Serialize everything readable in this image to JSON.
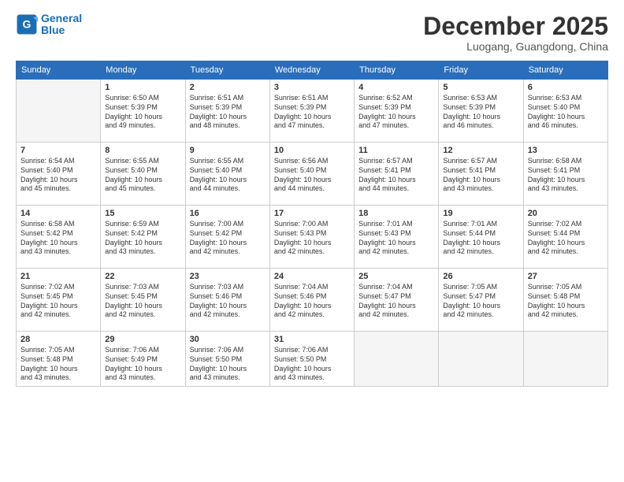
{
  "logo": {
    "line1": "General",
    "line2": "Blue"
  },
  "title": "December 2025",
  "location": "Luogang, Guangdong, China",
  "weekdays": [
    "Sunday",
    "Monday",
    "Tuesday",
    "Wednesday",
    "Thursday",
    "Friday",
    "Saturday"
  ],
  "weeks": [
    [
      {
        "day": "",
        "info": ""
      },
      {
        "day": "1",
        "info": "Sunrise: 6:50 AM\nSunset: 5:39 PM\nDaylight: 10 hours\nand 49 minutes."
      },
      {
        "day": "2",
        "info": "Sunrise: 6:51 AM\nSunset: 5:39 PM\nDaylight: 10 hours\nand 48 minutes."
      },
      {
        "day": "3",
        "info": "Sunrise: 6:51 AM\nSunset: 5:39 PM\nDaylight: 10 hours\nand 47 minutes."
      },
      {
        "day": "4",
        "info": "Sunrise: 6:52 AM\nSunset: 5:39 PM\nDaylight: 10 hours\nand 47 minutes."
      },
      {
        "day": "5",
        "info": "Sunrise: 6:53 AM\nSunset: 5:39 PM\nDaylight: 10 hours\nand 46 minutes."
      },
      {
        "day": "6",
        "info": "Sunrise: 6:53 AM\nSunset: 5:40 PM\nDaylight: 10 hours\nand 46 minutes."
      }
    ],
    [
      {
        "day": "7",
        "info": "Sunrise: 6:54 AM\nSunset: 5:40 PM\nDaylight: 10 hours\nand 45 minutes."
      },
      {
        "day": "8",
        "info": "Sunrise: 6:55 AM\nSunset: 5:40 PM\nDaylight: 10 hours\nand 45 minutes."
      },
      {
        "day": "9",
        "info": "Sunrise: 6:55 AM\nSunset: 5:40 PM\nDaylight: 10 hours\nand 44 minutes."
      },
      {
        "day": "10",
        "info": "Sunrise: 6:56 AM\nSunset: 5:40 PM\nDaylight: 10 hours\nand 44 minutes."
      },
      {
        "day": "11",
        "info": "Sunrise: 6:57 AM\nSunset: 5:41 PM\nDaylight: 10 hours\nand 44 minutes."
      },
      {
        "day": "12",
        "info": "Sunrise: 6:57 AM\nSunset: 5:41 PM\nDaylight: 10 hours\nand 43 minutes."
      },
      {
        "day": "13",
        "info": "Sunrise: 6:58 AM\nSunset: 5:41 PM\nDaylight: 10 hours\nand 43 minutes."
      }
    ],
    [
      {
        "day": "14",
        "info": "Sunrise: 6:58 AM\nSunset: 5:42 PM\nDaylight: 10 hours\nand 43 minutes."
      },
      {
        "day": "15",
        "info": "Sunrise: 6:59 AM\nSunset: 5:42 PM\nDaylight: 10 hours\nand 43 minutes."
      },
      {
        "day": "16",
        "info": "Sunrise: 7:00 AM\nSunset: 5:42 PM\nDaylight: 10 hours\nand 42 minutes."
      },
      {
        "day": "17",
        "info": "Sunrise: 7:00 AM\nSunset: 5:43 PM\nDaylight: 10 hours\nand 42 minutes."
      },
      {
        "day": "18",
        "info": "Sunrise: 7:01 AM\nSunset: 5:43 PM\nDaylight: 10 hours\nand 42 minutes."
      },
      {
        "day": "19",
        "info": "Sunrise: 7:01 AM\nSunset: 5:44 PM\nDaylight: 10 hours\nand 42 minutes."
      },
      {
        "day": "20",
        "info": "Sunrise: 7:02 AM\nSunset: 5:44 PM\nDaylight: 10 hours\nand 42 minutes."
      }
    ],
    [
      {
        "day": "21",
        "info": "Sunrise: 7:02 AM\nSunset: 5:45 PM\nDaylight: 10 hours\nand 42 minutes."
      },
      {
        "day": "22",
        "info": "Sunrise: 7:03 AM\nSunset: 5:45 PM\nDaylight: 10 hours\nand 42 minutes."
      },
      {
        "day": "23",
        "info": "Sunrise: 7:03 AM\nSunset: 5:46 PM\nDaylight: 10 hours\nand 42 minutes."
      },
      {
        "day": "24",
        "info": "Sunrise: 7:04 AM\nSunset: 5:46 PM\nDaylight: 10 hours\nand 42 minutes."
      },
      {
        "day": "25",
        "info": "Sunrise: 7:04 AM\nSunset: 5:47 PM\nDaylight: 10 hours\nand 42 minutes."
      },
      {
        "day": "26",
        "info": "Sunrise: 7:05 AM\nSunset: 5:47 PM\nDaylight: 10 hours\nand 42 minutes."
      },
      {
        "day": "27",
        "info": "Sunrise: 7:05 AM\nSunset: 5:48 PM\nDaylight: 10 hours\nand 42 minutes."
      }
    ],
    [
      {
        "day": "28",
        "info": "Sunrise: 7:05 AM\nSunset: 5:48 PM\nDaylight: 10 hours\nand 43 minutes."
      },
      {
        "day": "29",
        "info": "Sunrise: 7:06 AM\nSunset: 5:49 PM\nDaylight: 10 hours\nand 43 minutes."
      },
      {
        "day": "30",
        "info": "Sunrise: 7:06 AM\nSunset: 5:50 PM\nDaylight: 10 hours\nand 43 minutes."
      },
      {
        "day": "31",
        "info": "Sunrise: 7:06 AM\nSunset: 5:50 PM\nDaylight: 10 hours\nand 43 minutes."
      },
      {
        "day": "",
        "info": ""
      },
      {
        "day": "",
        "info": ""
      },
      {
        "day": "",
        "info": ""
      }
    ]
  ]
}
